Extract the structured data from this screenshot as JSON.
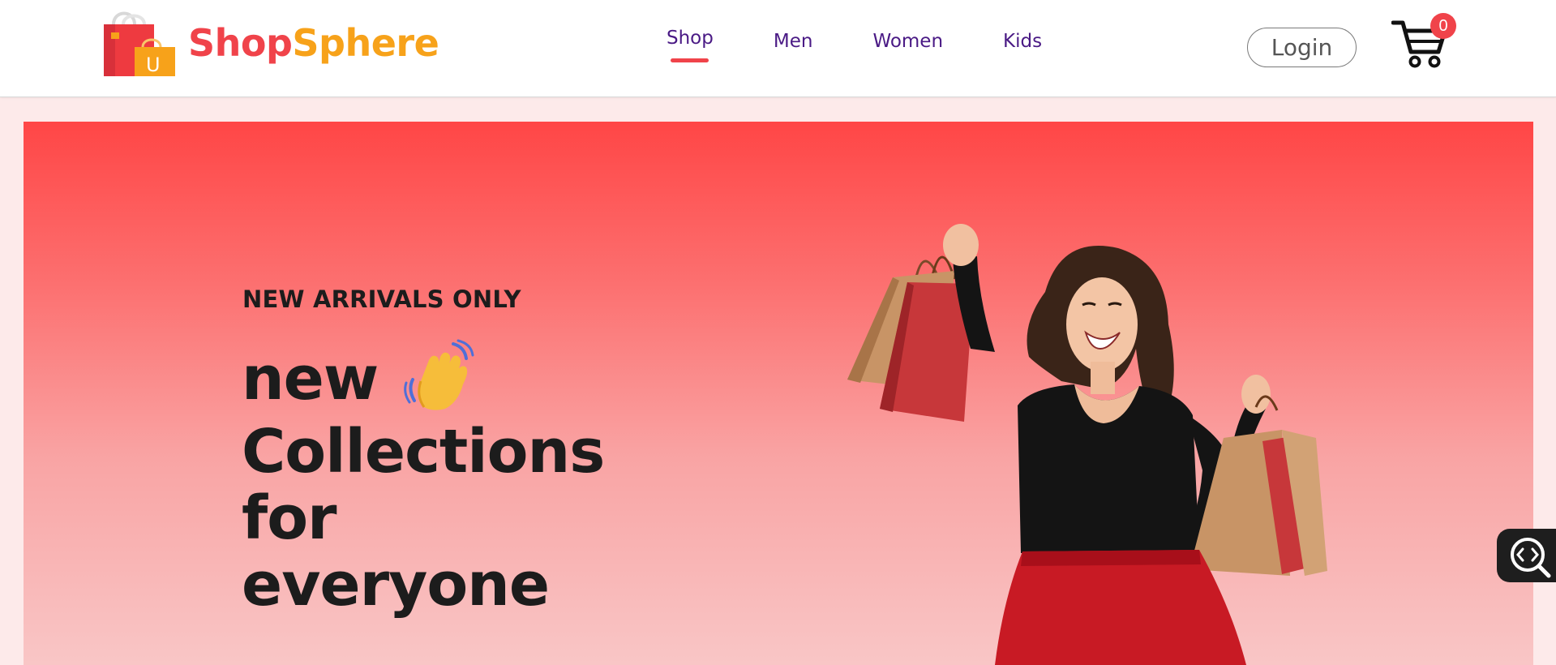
{
  "brand": {
    "name_part1": "Shop",
    "name_part2": "Sphere",
    "logo_bag_letter": "U"
  },
  "nav": {
    "items": [
      {
        "label": "Shop",
        "active": true
      },
      {
        "label": "Men",
        "active": false
      },
      {
        "label": "Women",
        "active": false
      },
      {
        "label": "Kids",
        "active": false
      }
    ]
  },
  "header": {
    "login_label": "Login",
    "cart_count": "0"
  },
  "hero": {
    "tagline": "NEW ARRIVALS ONLY",
    "headline_lines": [
      "new",
      "Collections",
      "for",
      "everyone"
    ],
    "wave_icon": "waving-hand-icon"
  },
  "colors": {
    "accent_red": "#f0434a",
    "accent_orange": "#f7a21a",
    "nav_purple": "#4a1a85",
    "hero_top": "#ff4646",
    "hero_bottom": "#f9c6c6"
  },
  "icons": {
    "cart": "shopping-cart-icon",
    "side_widget": "code-search-icon"
  }
}
